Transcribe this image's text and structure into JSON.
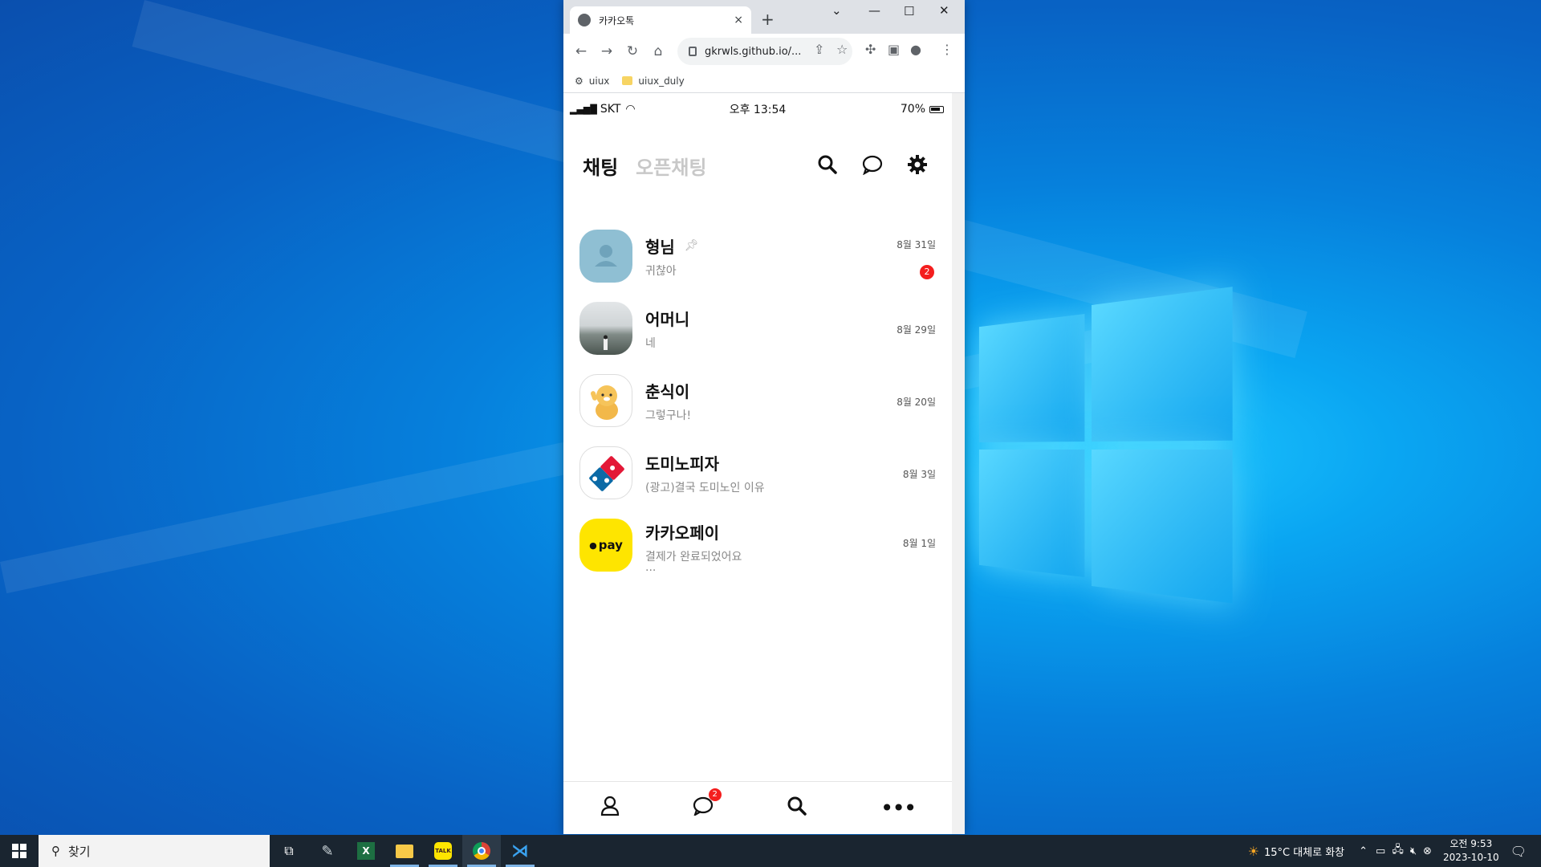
{
  "browser": {
    "tab_title": "카카오톡",
    "tab_close": "×",
    "new_tab": "+",
    "url": "gkrwls.github.io/...",
    "bookmarks": [
      "uiux",
      "uiux_duly"
    ]
  },
  "status_bar": {
    "carrier": "SKT",
    "time": "오후 13:54",
    "battery": "70%"
  },
  "header": {
    "tab_active": "채팅",
    "tab_inactive": "오픈채팅"
  },
  "chats": [
    {
      "name": "형님",
      "message": "귀찮아",
      "date": "8월 31일",
      "unread": "2",
      "pinned": true
    },
    {
      "name": "어머니",
      "message": "네",
      "date": "8월 29일"
    },
    {
      "name": "춘식이",
      "message": "그렇구나!",
      "date": "8월 20일"
    },
    {
      "name": "도미노피자",
      "message": "(광고)결국 도미노인 이유",
      "date": "8월 3일"
    },
    {
      "name": "카카오페이",
      "message": "결제가 완료되었어요",
      "message_more": "...",
      "date": "8월 1일",
      "logo_text": "pay"
    }
  ],
  "bottom_nav": {
    "chat_badge": "2"
  },
  "taskbar": {
    "search_placeholder": "찾기",
    "weather": "15°C  대체로 화창",
    "clock_time": "오전 9:53",
    "clock_date": "2023-10-10"
  },
  "colors": {
    "kakao_yellow": "#fee500",
    "badge_red": "#f41e1e",
    "avatar_blue": "#8fbfd3"
  }
}
